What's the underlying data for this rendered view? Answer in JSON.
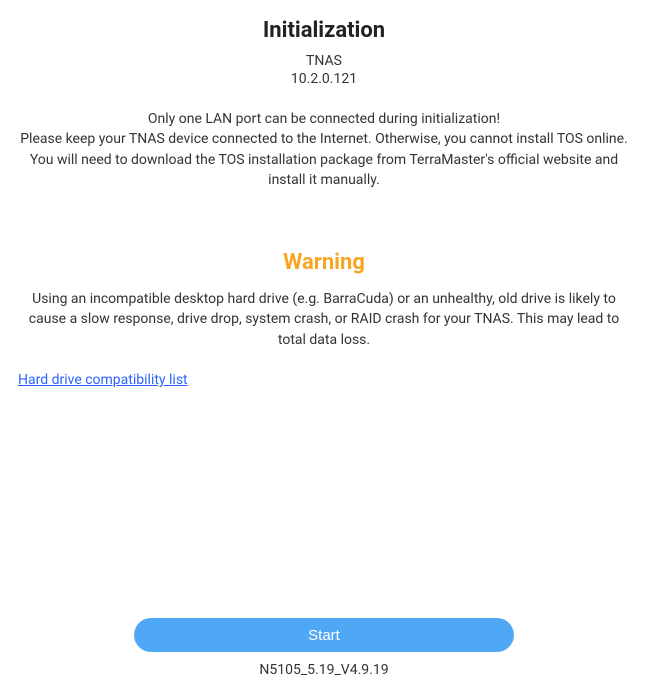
{
  "header": {
    "title": "Initialization",
    "device_name": "TNAS",
    "ip_address": "10.2.0.121"
  },
  "info": {
    "text": "Only one LAN port can be connected during initialization!\nPlease keep your TNAS device connected to the Internet. Otherwise, you cannot install TOS online. You will need to download the TOS installation package from TerraMaster's official website and install it manually."
  },
  "warning": {
    "title": "Warning",
    "text": "Using an incompatible desktop hard drive (e.g. BarraCuda) or an unhealthy, old drive is likely to cause a slow response, drive drop, system crash, or RAID crash for your TNAS. This may lead to total data loss."
  },
  "compat_link": {
    "label": "Hard drive compatibility list"
  },
  "footer": {
    "start_label": "Start",
    "version": "N5105_5.19_V4.9.19"
  },
  "colors": {
    "warning_accent": "#f5a623",
    "link": "#2962ff",
    "button_bg": "#4ea8f5"
  }
}
